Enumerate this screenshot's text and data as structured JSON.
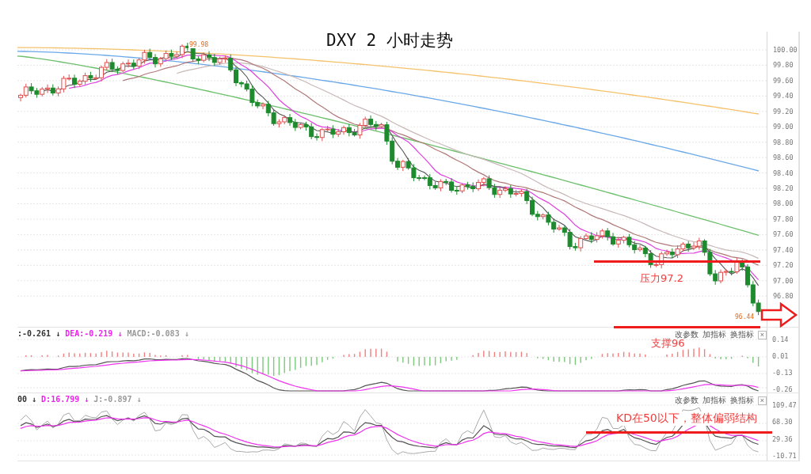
{
  "title": "DXY 2 小时走势",
  "main_chart": {
    "peak_label": "99.98",
    "low_label": "96.44",
    "axis_labels": [
      "100.00",
      "99.80",
      "99.60",
      "99.40",
      "99.20",
      "99.00",
      "98.80",
      "98.60",
      "98.40",
      "98.20",
      "98.00",
      "97.80",
      "97.60",
      "97.40",
      "97.20",
      "97.00",
      "96.80"
    ]
  },
  "macd_panel": {
    "readouts": [
      {
        "text": ":-0.261 ↓",
        "color": "#333333"
      },
      {
        "text": "DEA:-0.219 ↓",
        "color": "#ee22ee"
      },
      {
        "text": "MACD:-0.083 ↓",
        "color": "#999999"
      }
    ],
    "tools": [
      "改参数",
      "加指标",
      "换指标"
    ],
    "close": "×",
    "axis_labels": [
      "0.14",
      "0.01",
      "-0.13",
      "-0.26"
    ]
  },
  "kdj_panel": {
    "readouts": [
      {
        "text": "00 ↓",
        "color": "#333333"
      },
      {
        "text": "D:16.799 ↓",
        "color": "#ee22ee"
      },
      {
        "text": "J:-0.897 ↓",
        "color": "#999999"
      }
    ],
    "tools": [
      "改参数",
      "加指标",
      "换指标"
    ],
    "close": "×",
    "axis_labels": [
      "109.47",
      "68.30",
      "29.36",
      "-10.71"
    ]
  },
  "annotations": [
    {
      "kind": "resistance",
      "text": "压力97.2"
    },
    {
      "kind": "support",
      "text": "支撑96"
    },
    {
      "kind": "kd-note",
      "text": "KD在50以下，整体偏弱结构"
    }
  ]
}
